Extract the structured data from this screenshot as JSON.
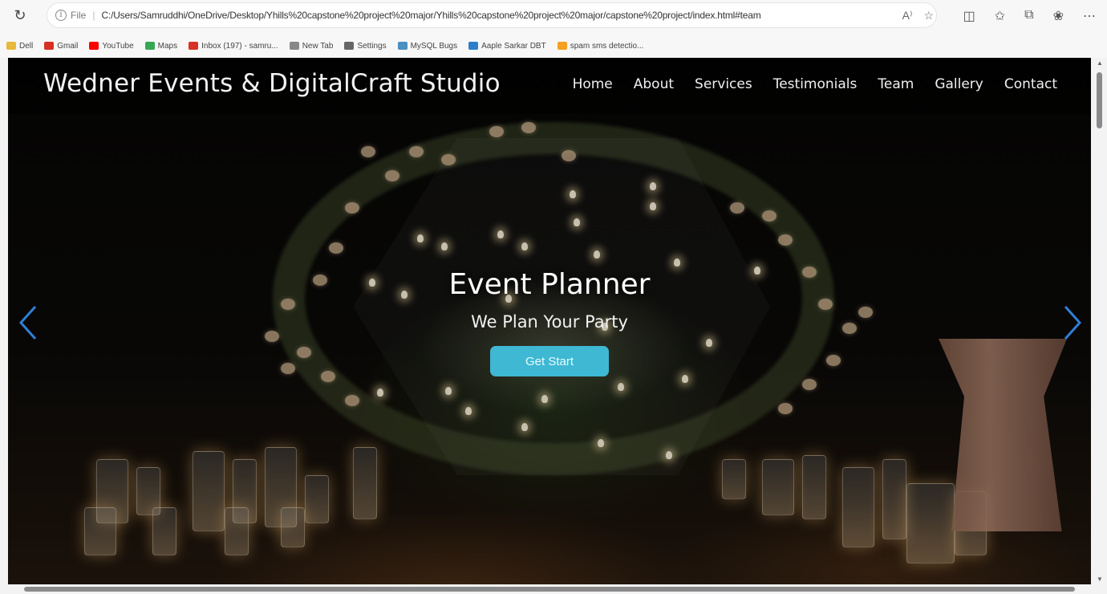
{
  "browser": {
    "url_prefix": "File",
    "url": "C:/Users/Samruddhi/OneDrive/Desktop/Yhills%20capstone%20project%20major/Yhills%20capstone%20project%20major/capstone%20project/index.html#team",
    "bookmarks": [
      {
        "label": "Dell",
        "color": "#e8b93a"
      },
      {
        "label": "Gmail",
        "color": "#d93025"
      },
      {
        "label": "YouTube",
        "color": "#ff0000"
      },
      {
        "label": "Maps",
        "color": "#34a853"
      },
      {
        "label": "Inbox (197) - samru...",
        "color": "#d93025"
      },
      {
        "label": "New Tab",
        "color": "#888888"
      },
      {
        "label": "Settings",
        "color": "#666666"
      },
      {
        "label": "MySQL Bugs",
        "color": "#4a90c2"
      },
      {
        "label": "Aaple Sarkar DBT",
        "color": "#2f7ec9"
      },
      {
        "label": "spam sms detectio...",
        "color": "#f4a020"
      }
    ]
  },
  "site": {
    "brand": "Wedner Events & DigitalCraft Studio",
    "nav": [
      "Home",
      "About",
      "Services",
      "Testimonials",
      "Team",
      "Gallery",
      "Contact"
    ],
    "hero": {
      "title": "Event Planner",
      "subtitle": "We Plan Your Party",
      "cta": "Get Start"
    },
    "accent": "#3fb8d3",
    "arrow_color": "#2f7fd6"
  }
}
